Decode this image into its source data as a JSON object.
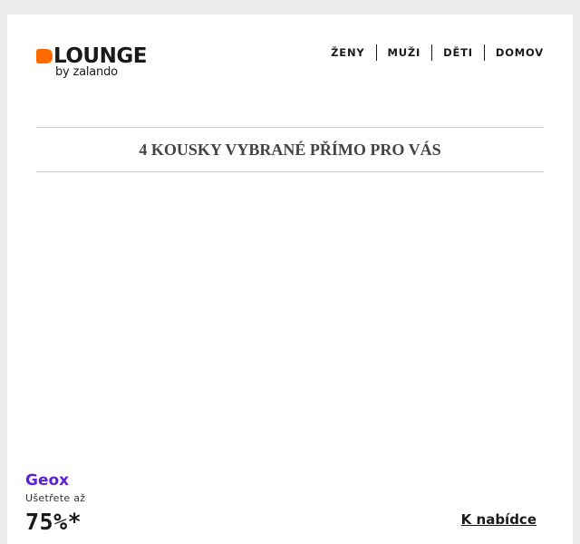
{
  "header": {
    "logo": {
      "wordmark": "LOUNGE",
      "tagline": "by zalando",
      "mark_color": "#ff6900"
    },
    "nav": [
      {
        "label": "ŽENY"
      },
      {
        "label": "MUŽI"
      },
      {
        "label": "DĚTI"
      },
      {
        "label": "DOMOV"
      }
    ]
  },
  "section": {
    "title": "4 KOUSKY VYBRANÉ PŘÍMO PRO VÁS"
  },
  "offer": {
    "brand": "Geox",
    "save_label": "Ušetřete až",
    "discount": "75%*",
    "cta": "K nabídce",
    "brand_color": "#5a1fd6"
  }
}
